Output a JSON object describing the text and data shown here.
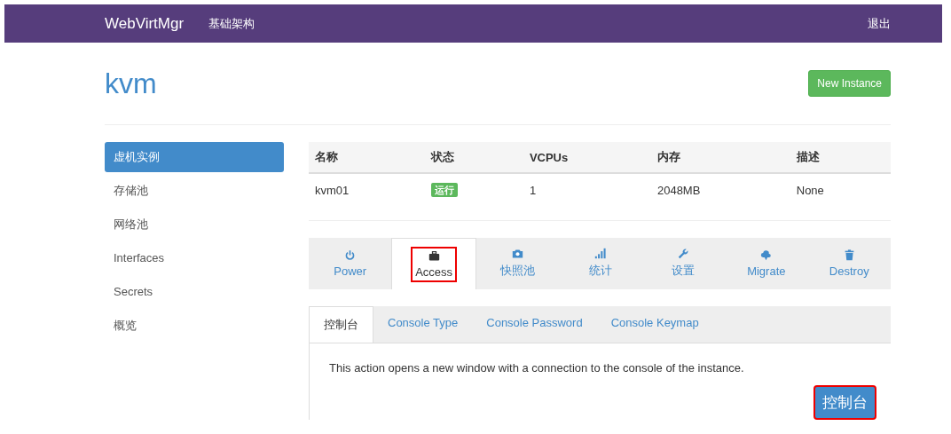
{
  "navbar": {
    "brand": "WebVirtMgr",
    "links": [
      "基础架构"
    ],
    "logout": "退出"
  },
  "page": {
    "title": "kvm",
    "new_button": "New Instance"
  },
  "sidebar": {
    "items": [
      {
        "label": "虚机实例",
        "selected": true
      },
      {
        "label": "存储池",
        "selected": false
      },
      {
        "label": "网络池",
        "selected": false
      },
      {
        "label": "Interfaces",
        "selected": false
      },
      {
        "label": "Secrets",
        "selected": false
      },
      {
        "label": "概览",
        "selected": false
      }
    ]
  },
  "table": {
    "columns": [
      "名称",
      "状态",
      "VCPUs",
      "内存",
      "描述"
    ],
    "rows": [
      {
        "name": "kvm01",
        "status": "运行",
        "vcpus": "1",
        "memory": "2048MB",
        "description": "None"
      }
    ]
  },
  "action_tabs": [
    {
      "label": "Power",
      "kind": "power",
      "selected": false,
      "highlighted": false
    },
    {
      "label": "Access",
      "kind": "briefcase",
      "selected": true,
      "highlighted": true
    },
    {
      "label": "快照池",
      "kind": "camera",
      "selected": false,
      "highlighted": false
    },
    {
      "label": "统计",
      "kind": "signal",
      "selected": false,
      "highlighted": false
    },
    {
      "label": "设置",
      "kind": "wrench",
      "selected": false,
      "highlighted": false
    },
    {
      "label": "Migrate",
      "kind": "cloud",
      "selected": false,
      "highlighted": false
    },
    {
      "label": "Destroy",
      "kind": "trash",
      "selected": false,
      "highlighted": false
    }
  ],
  "access_tabs": [
    {
      "label": "控制台",
      "selected": true
    },
    {
      "label": "Console Type",
      "selected": false
    },
    {
      "label": "Console Password",
      "selected": false
    },
    {
      "label": "Console Keymap",
      "selected": false
    }
  ],
  "panel": {
    "text": "This action opens a new window with a connection to the console of the instance.",
    "button": "控制台",
    "button_highlighted": true
  }
}
